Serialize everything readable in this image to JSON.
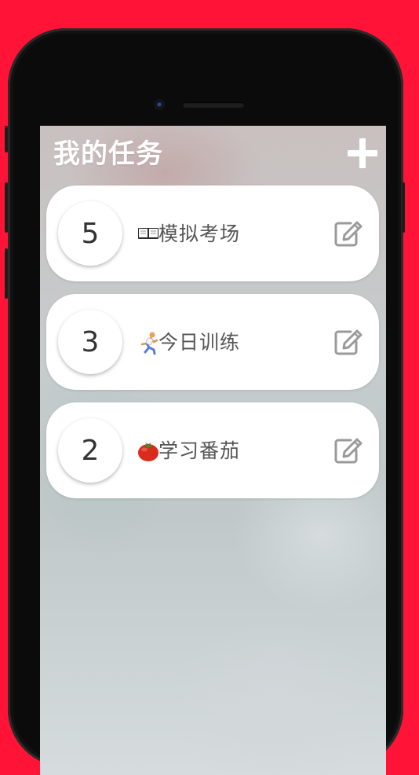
{
  "header": {
    "title": "我的任务",
    "add_icon": "plus-icon"
  },
  "tasks": [
    {
      "count": "5",
      "emoji_icon": "book-icon",
      "name": "模拟考场",
      "edit_icon": "edit-icon"
    },
    {
      "count": "3",
      "emoji_icon": "runner-icon",
      "name": "今日训练",
      "edit_icon": "edit-icon"
    },
    {
      "count": "2",
      "emoji_icon": "tomato-icon",
      "name": "学习番茄",
      "edit_icon": "edit-icon"
    }
  ],
  "colors": {
    "background": "#ff1337",
    "card": "#ffffff",
    "title": "#ffffff",
    "task_text": "#555555",
    "edit_icon": "#9a9a9a"
  }
}
